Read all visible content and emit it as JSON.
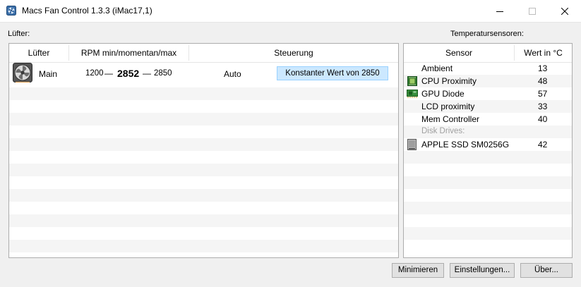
{
  "window": {
    "title": "Macs Fan Control 1.3.3 (iMac17,1)"
  },
  "fans_panel": {
    "label": "Lüfter:",
    "columns": {
      "fan": "Lüfter",
      "rpm": "RPM min/momentan/max",
      "control": "Steuerung"
    },
    "rows": [
      {
        "name": "Main",
        "rpm_min": "1200",
        "rpm_current": "2852",
        "rpm_max": "2850",
        "mode": "Auto",
        "control_button": "Konstanter Wert von 2850"
      }
    ]
  },
  "sensors_panel": {
    "label": "Temperatursensoren:",
    "columns": {
      "sensor": "Sensor",
      "value": "Wert in °C"
    },
    "rows": [
      {
        "name": "Ambient",
        "value": "13",
        "icon": ""
      },
      {
        "name": "CPU Proximity",
        "value": "48",
        "icon": "cpu-chip-icon"
      },
      {
        "name": "GPU Diode",
        "value": "57",
        "icon": "gpu-card-icon"
      },
      {
        "name": "LCD proximity",
        "value": "33",
        "icon": ""
      },
      {
        "name": "Mem Controller",
        "value": "40",
        "icon": ""
      }
    ],
    "group_label": "Disk Drives:",
    "disk_rows": [
      {
        "name": "APPLE SSD SM0256G",
        "value": "42",
        "icon": "ssd-drive-icon"
      }
    ]
  },
  "footer": {
    "minimize": "Minimieren",
    "settings": "Einstellungen...",
    "about": "Über..."
  },
  "colors": {
    "selected_button": "#cce8ff",
    "stripe": "#f5f5f5",
    "disk_group_text": "#a0a0a0"
  }
}
